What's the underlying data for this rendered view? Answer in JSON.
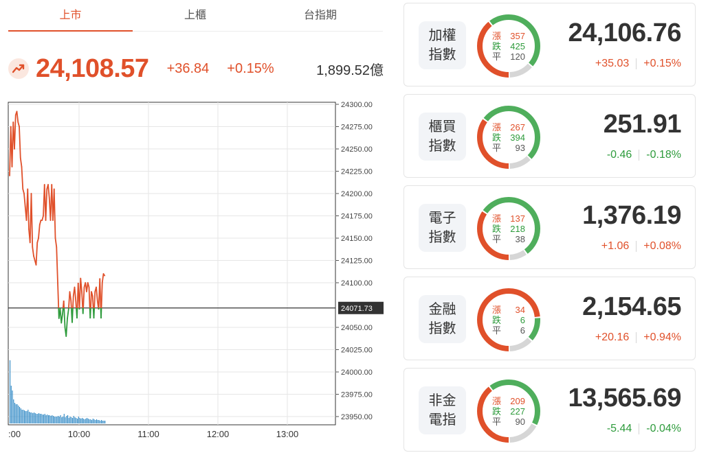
{
  "tabs": [
    {
      "label": "上市",
      "active": true
    },
    {
      "label": "上櫃",
      "active": false
    },
    {
      "label": "台指期",
      "active": false
    }
  ],
  "quote": {
    "icon": "trend-up-icon",
    "price": "24,108.57",
    "change": "+36.84",
    "percent": "+0.15%",
    "volume": "1,899.52億"
  },
  "chart_data": {
    "type": "line",
    "reference": 24071.73,
    "reference_label": "24071.73",
    "y_ticks": [
      "24300.00",
      "24275.00",
      "24250.00",
      "24225.00",
      "24200.00",
      "24175.00",
      "24150.00",
      "24125.00",
      "24100.00",
      "24050.00",
      "24025.00",
      "24000.00",
      "23975.00",
      "23950.00"
    ],
    "x_ticks": [
      ":00",
      "10:00",
      "11:00",
      "12:00",
      "13:00"
    ],
    "ylim": [
      23940,
      24305
    ],
    "x_range_minutes": [
      0,
      270
    ],
    "colors": {
      "up": "#e0502a",
      "down": "#2e9b3c",
      "volume": "#2a86c4"
    },
    "series": [
      {
        "x": [
          0,
          1,
          2,
          3,
          4,
          5,
          6,
          7,
          8,
          9,
          10,
          11,
          12,
          13,
          14,
          15,
          16,
          17,
          18,
          19,
          20,
          21,
          22,
          23,
          24,
          25,
          26,
          27,
          28,
          29,
          30,
          31,
          32,
          33,
          34,
          35,
          36,
          37,
          38,
          39,
          40,
          41,
          42,
          43,
          44,
          45,
          46,
          47,
          48,
          49,
          50,
          51,
          52,
          53,
          54,
          55,
          56,
          57,
          58,
          59,
          60,
          61,
          62,
          63,
          64,
          65,
          66,
          67,
          68,
          69,
          70,
          71,
          72,
          73,
          74,
          75,
          76,
          77,
          78,
          79
        ],
        "y": [
          24220,
          24275,
          24230,
          24280,
          24250,
          24288,
          24292,
          24280,
          24275,
          24240,
          24230,
          24205,
          24200,
          24185,
          24170,
          24205,
          24160,
          24145,
          24200,
          24140,
          24130,
          24125,
          24120,
          24145,
          24150,
          24165,
          24170,
          24170,
          24175,
          24210,
          24170,
          24205,
          24210,
          24195,
          24170,
          24210,
          24170,
          24205,
          24150,
          24140,
          24100,
          24060,
          24071,
          24055,
          24065,
          24080,
          24050,
          24040,
          24060,
          24070,
          24090,
          24080,
          24055,
          24085,
          24095,
          24080,
          24060,
          24100,
          24070,
          24105,
          24090,
          24065,
          24095,
          24100,
          24090,
          24100,
          24095,
          24060,
          24090,
          24085,
          24060,
          24090,
          24095,
          24080,
          24070,
          24105,
          24060,
          24100,
          24110,
          24108
        ]
      }
    ],
    "volume": [
      92,
      55,
      48,
      35,
      30,
      28,
      28,
      26,
      24,
      22,
      20,
      20,
      19,
      18,
      18,
      20,
      17,
      16,
      16,
      15,
      16,
      15,
      14,
      14,
      15,
      14,
      14,
      13,
      13,
      14,
      12,
      13,
      12,
      12,
      11,
      12,
      11,
      10,
      10,
      10,
      11,
      10,
      12,
      9,
      10,
      14,
      9,
      11,
      12,
      8,
      10,
      9,
      8,
      11,
      9,
      8,
      7,
      10,
      8,
      7,
      8,
      7,
      6,
      7,
      8,
      7,
      6,
      6,
      5,
      7,
      6,
      5,
      6,
      5,
      5,
      4,
      5,
      4,
      4,
      4
    ]
  },
  "indices": [
    {
      "name_line1": "加權",
      "name_line2": "指數",
      "value": "24,106.76",
      "change": "+35.03",
      "percent": "+0.15%",
      "direction": "up",
      "rise": "357",
      "fall": "425",
      "flat": "120",
      "rise_label": "漲",
      "fall_label": "跌",
      "flat_label": "平"
    },
    {
      "name_line1": "櫃買",
      "name_line2": "指數",
      "value": "251.91",
      "change": "-0.46",
      "percent": "-0.18%",
      "direction": "down",
      "rise": "267",
      "fall": "394",
      "flat": "93",
      "rise_label": "漲",
      "fall_label": "跌",
      "flat_label": "平"
    },
    {
      "name_line1": "電子",
      "name_line2": "指數",
      "value": "1,376.19",
      "change": "+1.06",
      "percent": "+0.08%",
      "direction": "up",
      "rise": "137",
      "fall": "218",
      "flat": "38",
      "rise_label": "漲",
      "fall_label": "跌",
      "flat_label": "平"
    },
    {
      "name_line1": "金融",
      "name_line2": "指數",
      "value": "2,154.65",
      "change": "+20.16",
      "percent": "+0.94%",
      "direction": "up",
      "rise": "34",
      "fall": "6",
      "flat": "6",
      "rise_label": "漲",
      "fall_label": "跌",
      "flat_label": "平"
    },
    {
      "name_line1": "非金",
      "name_line2": "電指",
      "value": "13,565.69",
      "change": "-5.44",
      "percent": "-0.04%",
      "direction": "down",
      "rise": "209",
      "fall": "227",
      "flat": "90",
      "rise_label": "漲",
      "fall_label": "跌",
      "flat_label": "平"
    }
  ]
}
